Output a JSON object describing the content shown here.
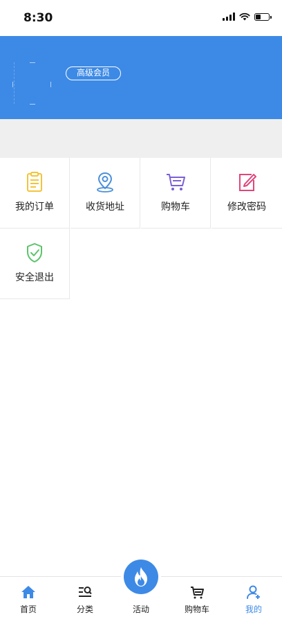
{
  "status_bar": {
    "time": "8:30",
    "battery_level": 0.35
  },
  "profile": {
    "member_badge": "高级会员"
  },
  "menu": {
    "items": [
      {
        "label": "我的订单",
        "icon": "order-clipboard-icon",
        "color": "#f3c43a"
      },
      {
        "label": "收货地址",
        "icon": "location-pin-icon",
        "color": "#4a90d9"
      },
      {
        "label": "购物车",
        "icon": "shopping-cart-icon",
        "color": "#7b5fd6"
      },
      {
        "label": "修改密码",
        "icon": "edit-password-icon",
        "color": "#e0457b"
      },
      {
        "label": "安全退出",
        "icon": "shield-check-icon",
        "color": "#5cc36b"
      }
    ]
  },
  "tab_bar": {
    "active_color": "#3d8ae6",
    "tabs": [
      {
        "label": "首页",
        "icon": "home-icon"
      },
      {
        "label": "分类",
        "icon": "category-search-icon"
      },
      {
        "label": "活动",
        "icon": "flame-icon"
      },
      {
        "label": "购物车",
        "icon": "cart-icon"
      },
      {
        "label": "我的",
        "icon": "user-add-icon",
        "active": true
      }
    ]
  },
  "colors": {
    "header": "#3d8ae6",
    "band": "#efefef"
  }
}
